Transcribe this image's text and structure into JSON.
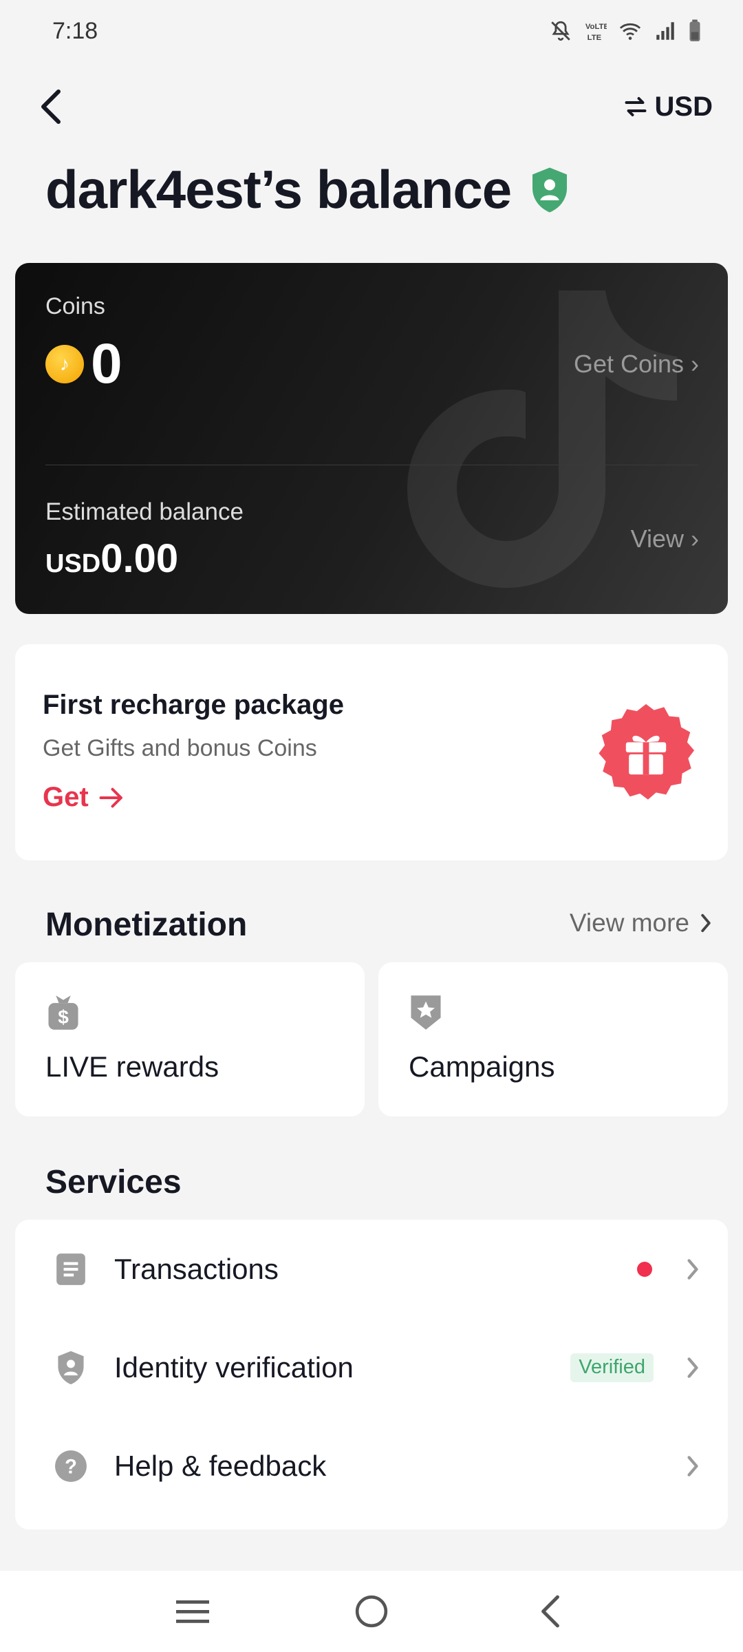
{
  "status_bar": {
    "time": "7:18",
    "icons": [
      "mute-icon",
      "volte-icon",
      "wifi-icon",
      "signal-icon",
      "battery-icon"
    ]
  },
  "header": {
    "back_icon": "chevron-left-icon",
    "currency_icon": "swap-icon",
    "currency": "USD"
  },
  "title": "dark4est’s balance",
  "title_icon": "shield-user-icon",
  "balance_card": {
    "coins_label": "Coins",
    "coins_value": "0",
    "get_coins": "Get Coins ›",
    "estimated_label": "Estimated balance",
    "estimated_currency": "USD",
    "estimated_value": "0.00",
    "view_link": "View ›"
  },
  "recharge": {
    "title": "First recharge package",
    "subtitle": "Get Gifts and bonus Coins",
    "cta": "Get",
    "icon": "gift-icon"
  },
  "monetization": {
    "title": "Monetization",
    "view_more": "View more",
    "cards": [
      {
        "label": "LIVE rewards",
        "icon": "money-bag-icon"
      },
      {
        "label": "Campaigns",
        "icon": "badge-star-icon"
      }
    ]
  },
  "services": {
    "title": "Services",
    "items": [
      {
        "label": "Transactions",
        "icon": "document-icon",
        "has_dot": true
      },
      {
        "label": "Identity verification",
        "icon": "shield-user-icon",
        "badge": "Verified"
      },
      {
        "label": "Help & feedback",
        "icon": "question-icon"
      }
    ]
  },
  "colors": {
    "accent": "#e8344e",
    "verified_green": "#3da66c",
    "shield_green": "#45a872"
  }
}
